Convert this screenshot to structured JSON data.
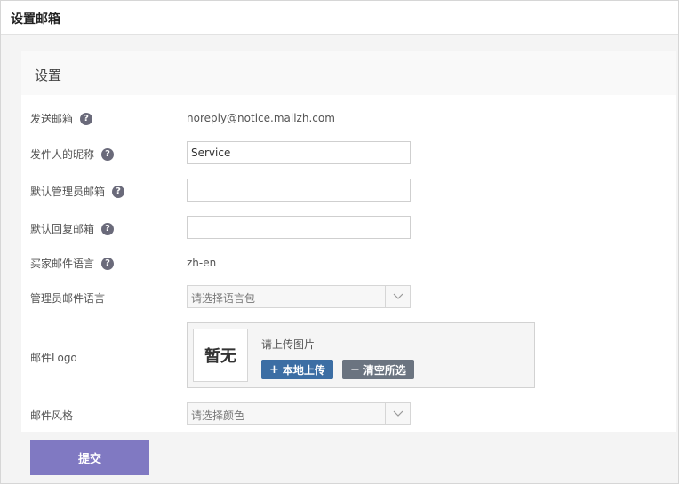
{
  "header": {
    "title": "设置邮箱"
  },
  "panel": {
    "title": "设置"
  },
  "form": {
    "sender_email": {
      "label": "发送邮箱",
      "value": "noreply@notice.mailzh.com"
    },
    "sender_nickname": {
      "label": "发件人的昵称",
      "value": "Service"
    },
    "admin_email": {
      "label": "默认管理员邮箱",
      "value": ""
    },
    "reply_email": {
      "label": "默认回复邮箱",
      "value": ""
    },
    "buyer_language": {
      "label": "买家邮件语言",
      "value": "zh-en"
    },
    "admin_language": {
      "label": "管理员邮件语言",
      "placeholder": "请选择语言包"
    },
    "logo": {
      "label": "邮件Logo",
      "preview_text": "暂无",
      "hint": "请上传图片",
      "upload_label": "本地上传",
      "upload_icon": "+",
      "clear_label": "清空所选",
      "clear_icon": "−"
    },
    "style": {
      "label": "邮件风格",
      "placeholder": "请选择颜色"
    },
    "help_symbol": "?"
  },
  "submit_label": "提交",
  "colors": {
    "submit": "#8079c2",
    "upload": "#3c6ea4",
    "clear": "#6b7480",
    "help_icon": "#6a6a7a"
  }
}
